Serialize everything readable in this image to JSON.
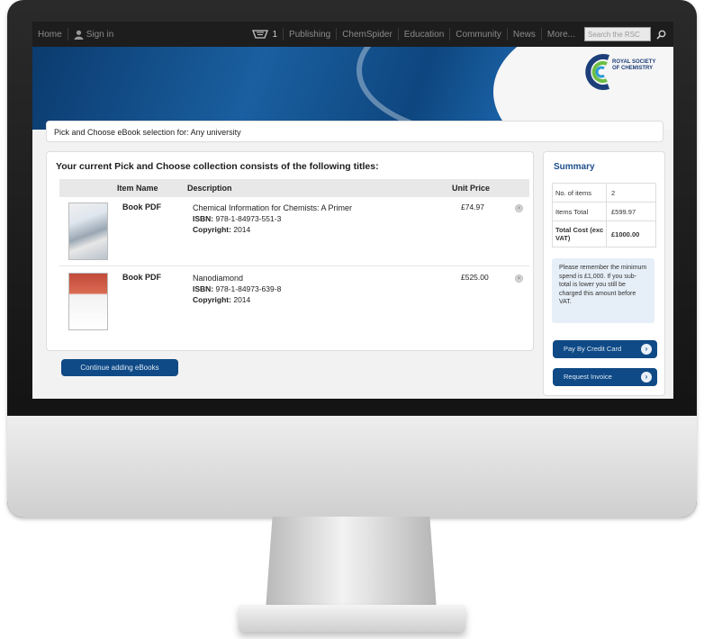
{
  "topnav": {
    "home": "Home",
    "sign_in": "Sign in",
    "basket_count": "1",
    "links": [
      "Publishing",
      "ChemSpider",
      "Education",
      "Community",
      "News",
      "More..."
    ],
    "search_placeholder": "Search the RSC"
  },
  "logo": {
    "line1": "ROYAL SOCIETY",
    "line2": "OF CHEMISTRY"
  },
  "selection_bar": "Pick and Choose eBook selection for: Any university",
  "collection": {
    "heading": "Your current Pick and Choose collection consists of the following titles:",
    "columns": [
      "Item Name",
      "Description",
      "Unit Price"
    ],
    "rows": [
      {
        "name": "Book PDF",
        "title": "Chemical Information for Chemists: A Primer",
        "isbn_label": "ISBN:",
        "isbn": "978-1-84973-551-3",
        "copyright_label": "Copyright:",
        "copyright": "2014",
        "price": "£74.97"
      },
      {
        "name": "Book PDF",
        "title": "Nanodiamond",
        "isbn_label": "ISBN:",
        "isbn": "978-1-84973-639-8",
        "copyright_label": "Copyright:",
        "copyright": "2014",
        "price": "£525.00"
      }
    ],
    "continue_button": "Continue adding eBooks"
  },
  "summary": {
    "title": "Summary",
    "rows": [
      {
        "label": "No. of items",
        "value": "2"
      },
      {
        "label": "Items Total",
        "value": "£599.97"
      },
      {
        "label": "Total Cost (exc VAT)",
        "value": "£1000.00"
      }
    ],
    "note": "Please remember the minimum spend is £1,000. If you sub-total is lower you still be charged this amount before VAT.",
    "pay_button": "Pay By Credit Card",
    "invoice_button": "Request Invoice"
  },
  "colors": {
    "accent": "#0f4a86",
    "nav_bg": "#1d1d1d",
    "banner": "#1a5fa0"
  }
}
